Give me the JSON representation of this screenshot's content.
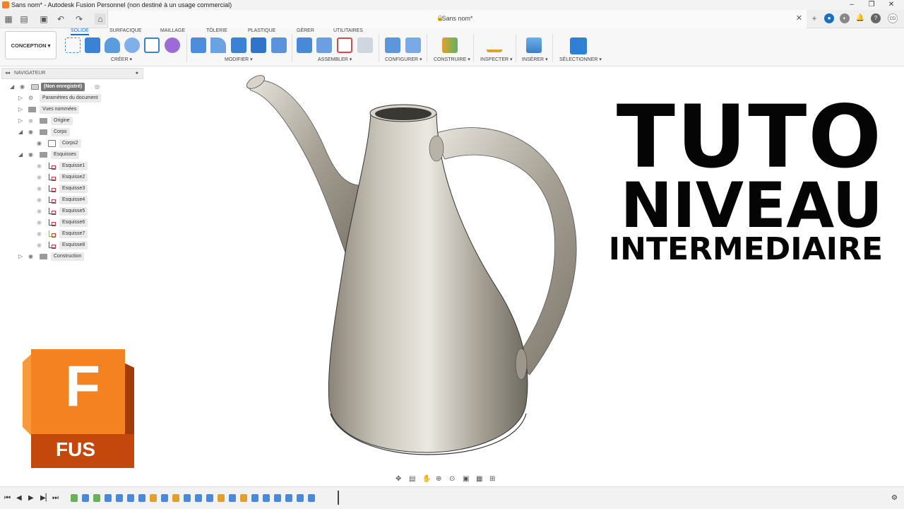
{
  "window": {
    "title": "Sans nom* - Autodesk Fusion Personnel (non destiné à un usage commercial)",
    "controls": [
      "–",
      "❐",
      "✕"
    ]
  },
  "document_tab": {
    "title": "Sans nom*"
  },
  "user_initials": "CD",
  "ribbon": {
    "workspace": "CONCEPTION",
    "tabs": [
      "SOLIDE",
      "SURFACIQUE",
      "MAILLAGE",
      "TÔLERIE",
      "PLASTIQUE",
      "GÉRER",
      "UTILITAIRES"
    ],
    "active_tab": "SOLIDE",
    "groups": [
      "CRÉER",
      "MODIFIER",
      "ASSEMBLER",
      "CONFIGURER",
      "CONSTRUIRE",
      "INSPECTER",
      "INSÉRER",
      "SÉLECTIONNER"
    ]
  },
  "browser": {
    "header": "NAVIGATEUR",
    "root": "(Non enregistré)",
    "items": [
      {
        "label": "Paramètres du document"
      },
      {
        "label": "Vues nommées"
      },
      {
        "label": "Origine"
      },
      {
        "label": "Corps"
      },
      {
        "label": "Corps2"
      },
      {
        "label": "Esquisses"
      },
      {
        "label": "Esquisse1"
      },
      {
        "label": "Esquisse2"
      },
      {
        "label": "Esquisse3"
      },
      {
        "label": "Esquisse4"
      },
      {
        "label": "Esquisse5"
      },
      {
        "label": "Esquisse6"
      },
      {
        "label": "Esquisse7"
      },
      {
        "label": "Esquisse8"
      },
      {
        "label": "Construction"
      }
    ]
  },
  "overlay": {
    "line1": "TUTO",
    "line2": "NIVEAU",
    "line3": "INTERMEDIAIRE"
  },
  "logo": {
    "letter": "F",
    "text": "FUS"
  },
  "colors": {
    "accent": "#1a6fc4",
    "fusion_orange": "#f58220",
    "logo_dark": "#c4470c",
    "model": "#b4afa4"
  }
}
